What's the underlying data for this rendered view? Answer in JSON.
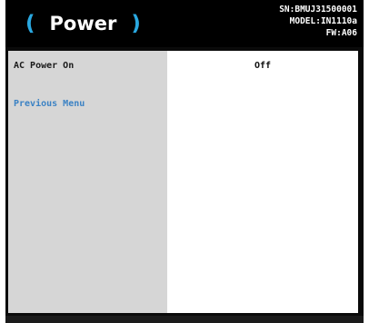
{
  "header": {
    "title": "Power",
    "paren_left": "(",
    "paren_right": ")",
    "serial": "SN:BMUJ31500001",
    "model": "MODEL:IN1110a",
    "firmware": "FW:A06"
  },
  "menu": {
    "items": [
      {
        "label": "AC Power On",
        "value": "Off"
      },
      {
        "label": "Previous Menu"
      }
    ]
  },
  "colors": {
    "accent": "#2aa8e0",
    "link": "#3b82c4",
    "header_bg": "#000000",
    "sidebar_bg": "#d6d6d6",
    "content_bg": "#ffffff"
  }
}
